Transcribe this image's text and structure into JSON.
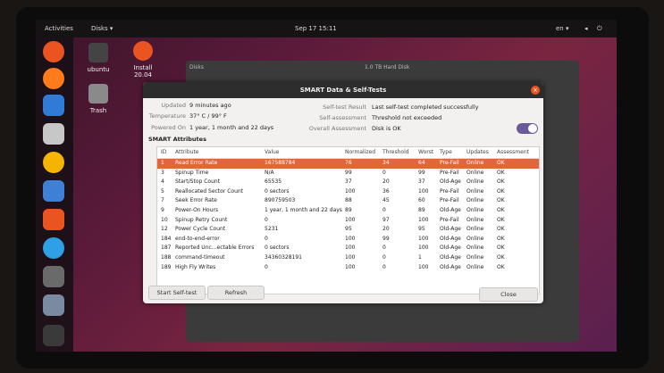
{
  "topbar": {
    "activities": "Activities",
    "app": "Disks ▾",
    "clock": "Sep 17  15:11",
    "lang": "en ▾"
  },
  "desktop": {
    "ubuntu_label": "ubuntu",
    "install_label": "Install\n20.04",
    "trash_label": "Trash"
  },
  "bg_window": {
    "left_title": "Disks",
    "right_title": "1.0 TB Hard Disk"
  },
  "dialog": {
    "title": "SMART Data & Self-Tests",
    "updated_label": "Updated",
    "updated_value": "9 minutes ago",
    "temperature_label": "Temperature",
    "temperature_value": "37° C / 99° F",
    "powered_label": "Powered On",
    "powered_value": "1 year, 1 month and 22 days",
    "selftest_label": "Self-test Result",
    "selftest_value": "Last self-test completed successfully",
    "selfassess_label": "Self-assessment",
    "selfassess_value": "Threshold not exceeded",
    "overall_label": "Overall Assessment",
    "overall_value": "Disk is OK",
    "section": "SMART Attributes",
    "start_button": "Start Self-test",
    "refresh_button": "Refresh",
    "close_button": "Close",
    "smart_enabled": true
  },
  "table": {
    "headers": [
      "ID",
      "Attribute",
      "Value",
      "Normalized",
      "Threshold",
      "Worst",
      "Type",
      "Updates",
      "Assessment"
    ],
    "rows": [
      [
        "1",
        "Read Error Rate",
        "167588784",
        "76",
        "34",
        "64",
        "Pre-Fail",
        "Online",
        "OK"
      ],
      [
        "3",
        "Spinup Time",
        "N/A",
        "99",
        "0",
        "99",
        "Pre-Fail",
        "Online",
        "OK"
      ],
      [
        "4",
        "Start/Stop Count",
        "65535",
        "37",
        "20",
        "37",
        "Old-Age",
        "Online",
        "OK"
      ],
      [
        "5",
        "Reallocated Sector Count",
        "0 sectors",
        "100",
        "36",
        "100",
        "Pre-Fail",
        "Online",
        "OK"
      ],
      [
        "7",
        "Seek Error Rate",
        "890759503",
        "88",
        "45",
        "60",
        "Pre-Fail",
        "Online",
        "OK"
      ],
      [
        "9",
        "Power-On Hours",
        "1 year, 1 month and 22 days",
        "89",
        "0",
        "89",
        "Old-Age",
        "Online",
        "OK"
      ],
      [
        "10",
        "Spinup Retry Count",
        "0",
        "100",
        "97",
        "100",
        "Pre-Fail",
        "Online",
        "OK"
      ],
      [
        "12",
        "Power Cycle Count",
        "5231",
        "95",
        "20",
        "95",
        "Old-Age",
        "Online",
        "OK"
      ],
      [
        "184",
        "end-to-end-error",
        "0",
        "100",
        "99",
        "100",
        "Old-Age",
        "Online",
        "OK"
      ],
      [
        "187",
        "Reported Unc...ectable Errors",
        "0 sectors",
        "100",
        "0",
        "100",
        "Old-Age",
        "Online",
        "OK"
      ],
      [
        "188",
        "command-timeout",
        "34360328191",
        "100",
        "0",
        "1",
        "Old-Age",
        "Online",
        "OK"
      ],
      [
        "189",
        "High Fly Writes",
        "0",
        "100",
        "0",
        "100",
        "Old-Age",
        "Online",
        "OK"
      ]
    ]
  },
  "colors": {
    "accent": "#e0673a",
    "toggle": "#6b5a9a",
    "close": "#e95420"
  }
}
